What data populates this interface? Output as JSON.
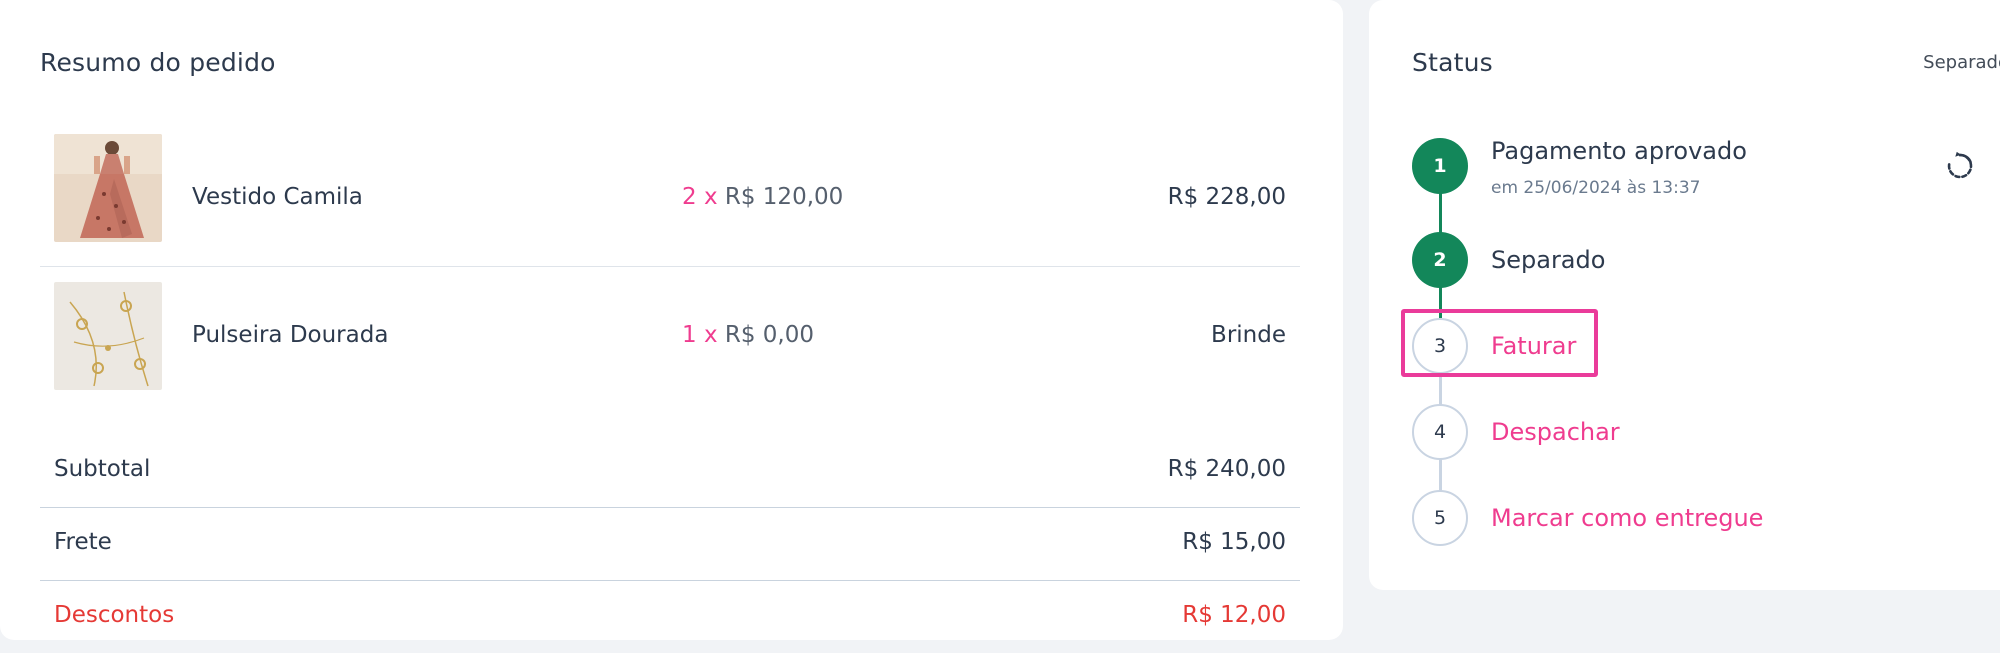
{
  "order_summary": {
    "title": "Resumo do pedido",
    "items": [
      {
        "name": "Vestido Camila",
        "quantity": "2 x",
        "unit_price": "R$ 120,00",
        "total": "R$ 228,00",
        "thumbnail": "dress-photo"
      },
      {
        "name": "Pulseira Dourada",
        "quantity": "1 x",
        "unit_price": "R$ 0,00",
        "total": "Brinde",
        "thumbnail": "bracelet-photo"
      }
    ],
    "subtotal": {
      "label": "Subtotal",
      "value": "R$ 240,00"
    },
    "shipping": {
      "label": "Frete",
      "value": "R$ 15,00"
    },
    "discounts": {
      "label": "Descontos",
      "value": "R$ 12,00"
    }
  },
  "status": {
    "title": "Status",
    "current": "Separado",
    "steps": [
      {
        "number": "1",
        "label": "Pagamento aprovado",
        "date": "em 25/06/2024 às 13:37"
      },
      {
        "number": "2",
        "label": "Separado"
      },
      {
        "number": "3",
        "label": "Faturar"
      },
      {
        "number": "4",
        "label": "Despachar"
      },
      {
        "number": "5",
        "label": "Marcar como entregue"
      }
    ],
    "refresh_icon": "refresh-icon"
  },
  "colors": {
    "accent_pink": "#ef3c8f",
    "done_green": "#13875a",
    "discount_red": "#e53935",
    "highlight": "#ea3b9a"
  }
}
